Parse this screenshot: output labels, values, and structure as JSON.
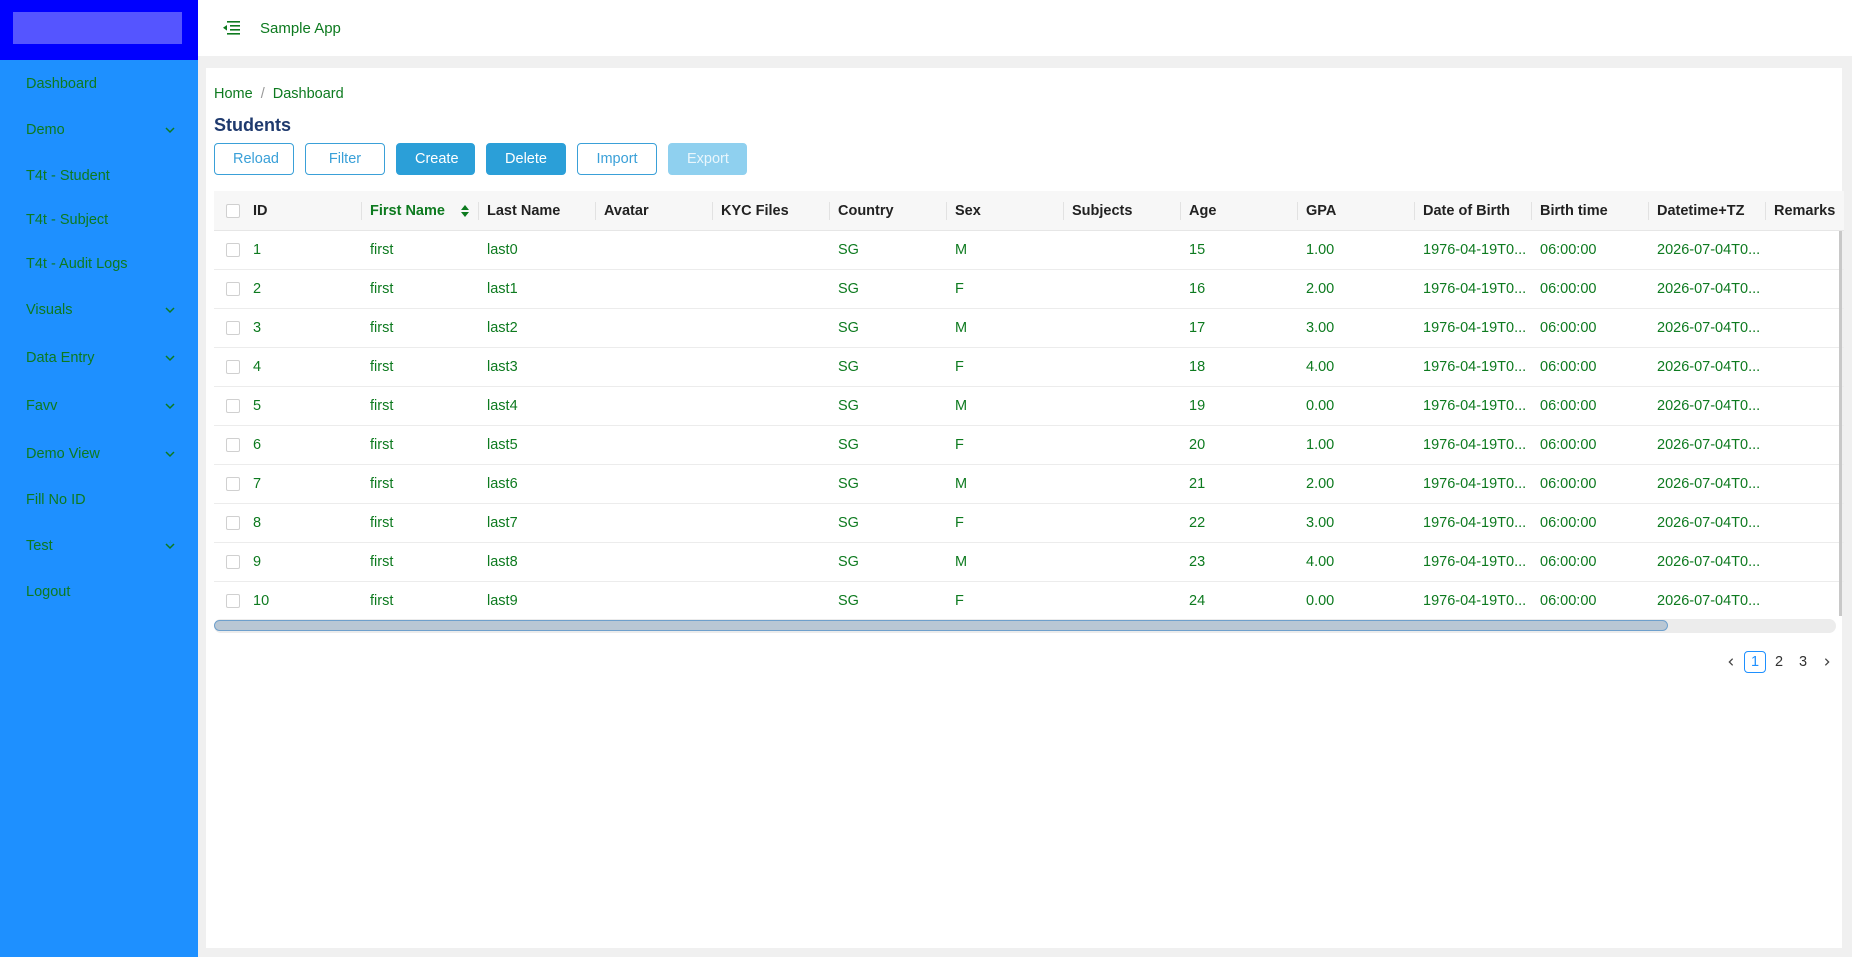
{
  "header": {
    "app_title": "Sample App",
    "menu_icon": "menu-fold-icon"
  },
  "sidebar": {
    "items": [
      {
        "label": "Dashboard",
        "expandable": false
      },
      {
        "label": "Demo",
        "expandable": true
      },
      {
        "label": "T4t - Student",
        "expandable": false
      },
      {
        "label": "T4t - Subject",
        "expandable": false
      },
      {
        "label": "T4t - Audit Logs",
        "expandable": false
      },
      {
        "label": "Visuals",
        "expandable": true
      },
      {
        "label": "Data Entry",
        "expandable": true
      },
      {
        "label": "Favv",
        "expandable": true
      },
      {
        "label": "Demo View",
        "expandable": true
      },
      {
        "label": "Fill No ID",
        "expandable": false
      },
      {
        "label": "Test",
        "expandable": true
      },
      {
        "label": "Logout",
        "expandable": false
      }
    ]
  },
  "breadcrumb": {
    "home": "Home",
    "separator": "/",
    "current": "Dashboard"
  },
  "page": {
    "title": "Students"
  },
  "toolbar": {
    "reload": "Reload",
    "filter": "Filter",
    "create": "Create",
    "delete": "Delete",
    "import": "Import",
    "export": "Export"
  },
  "table": {
    "columns": [
      "ID",
      "First Name",
      "Last Name",
      "Avatar",
      "KYC Files",
      "Country",
      "Sex",
      "Subjects",
      "Age",
      "GPA",
      "Date of Birth",
      "Birth time",
      "Datetime+TZ",
      "Remarks"
    ],
    "sorted_column": "First Name",
    "rows": [
      [
        "1",
        "first",
        "last0",
        "",
        "",
        "SG",
        "M",
        "",
        "15",
        "1.00",
        "1976-04-19T0...",
        "06:00:00",
        "2026-07-04T0...",
        ""
      ],
      [
        "2",
        "first",
        "last1",
        "",
        "",
        "SG",
        "F",
        "",
        "16",
        "2.00",
        "1976-04-19T0...",
        "06:00:00",
        "2026-07-04T0...",
        ""
      ],
      [
        "3",
        "first",
        "last2",
        "",
        "",
        "SG",
        "M",
        "",
        "17",
        "3.00",
        "1976-04-19T0...",
        "06:00:00",
        "2026-07-04T0...",
        ""
      ],
      [
        "4",
        "first",
        "last3",
        "",
        "",
        "SG",
        "F",
        "",
        "18",
        "4.00",
        "1976-04-19T0...",
        "06:00:00",
        "2026-07-04T0...",
        ""
      ],
      [
        "5",
        "first",
        "last4",
        "",
        "",
        "SG",
        "M",
        "",
        "19",
        "0.00",
        "1976-04-19T0...",
        "06:00:00",
        "2026-07-04T0...",
        ""
      ],
      [
        "6",
        "first",
        "last5",
        "",
        "",
        "SG",
        "F",
        "",
        "20",
        "1.00",
        "1976-04-19T0...",
        "06:00:00",
        "2026-07-04T0...",
        ""
      ],
      [
        "7",
        "first",
        "last6",
        "",
        "",
        "SG",
        "M",
        "",
        "21",
        "2.00",
        "1976-04-19T0...",
        "06:00:00",
        "2026-07-04T0...",
        ""
      ],
      [
        "8",
        "first",
        "last7",
        "",
        "",
        "SG",
        "F",
        "",
        "22",
        "3.00",
        "1976-04-19T0...",
        "06:00:00",
        "2026-07-04T0...",
        ""
      ],
      [
        "9",
        "first",
        "last8",
        "",
        "",
        "SG",
        "M",
        "",
        "23",
        "4.00",
        "1976-04-19T0...",
        "06:00:00",
        "2026-07-04T0...",
        ""
      ],
      [
        "10",
        "first",
        "last9",
        "",
        "",
        "SG",
        "F",
        "",
        "24",
        "0.00",
        "1976-04-19T0...",
        "06:00:00",
        "2026-07-04T0...",
        ""
      ]
    ]
  },
  "pagination": {
    "pages": [
      "1",
      "2",
      "3"
    ],
    "current": "1"
  },
  "colors": {
    "sidebar_bg": "#1e90ff",
    "logo_bg": "#0000ff",
    "text_green": "#0d7a1f",
    "primary": "#2b9fd8",
    "title_blue": "#1f3a6e"
  }
}
